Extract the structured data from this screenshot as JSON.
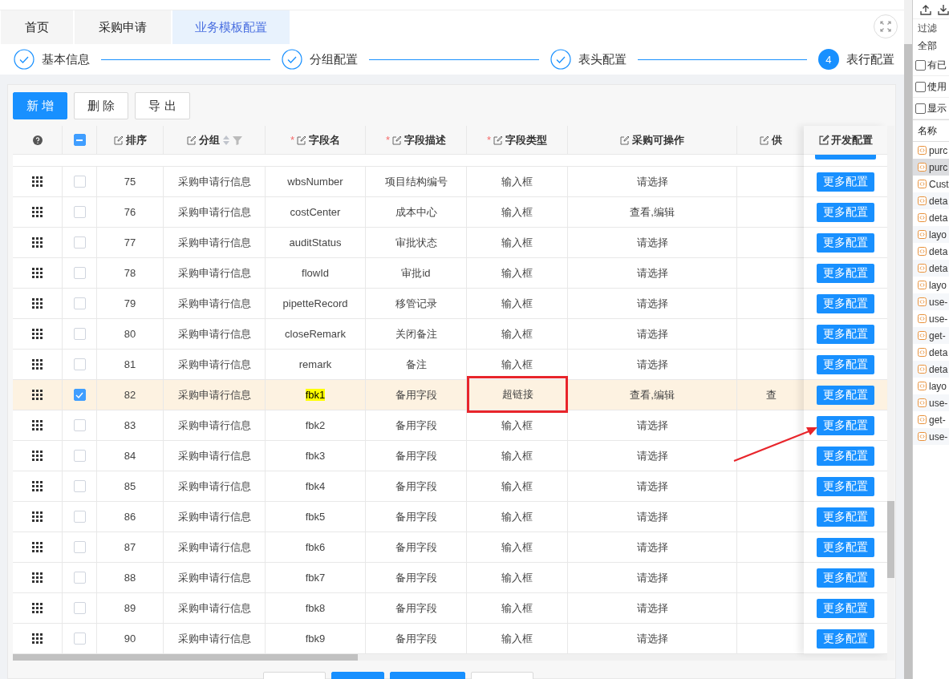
{
  "tabs": [
    {
      "label": "首页",
      "selected": false
    },
    {
      "label": "采购申请",
      "selected": false
    },
    {
      "label": "业务模板配置",
      "selected": true
    }
  ],
  "steps": [
    {
      "label": "基本信息",
      "done": true
    },
    {
      "label": "分组配置",
      "done": true
    },
    {
      "label": "表头配置",
      "done": true
    },
    {
      "label": "表行配置",
      "done": false,
      "number": "4"
    }
  ],
  "toolbar": [
    {
      "label": "新 增",
      "kind": "primary"
    },
    {
      "label": "删 除",
      "kind": "default"
    },
    {
      "label": "导 出",
      "kind": "default"
    }
  ],
  "table": {
    "header_indeterminate": true,
    "columns": [
      {
        "label": "排序"
      },
      {
        "label": "分组",
        "sortable": true
      },
      {
        "required_mark": "*",
        "label": "字段名"
      },
      {
        "required_mark": "*",
        "label": "字段描述"
      },
      {
        "required_mark": "*",
        "label": "字段类型"
      },
      {
        "label": "采购可操作"
      },
      {
        "label": "供"
      }
    ],
    "fixed_column": "开发配置",
    "rows": [
      {
        "order": "75",
        "group": "采购申请行信息",
        "field": "wbsNumber",
        "desc": "项目结构编号",
        "type": "输入框",
        "ops": "请选择",
        "action": "更多配置",
        "selected": false,
        "highlighted": false,
        "marked": false
      },
      {
        "order": "76",
        "group": "采购申请行信息",
        "field": "costCenter",
        "desc": "成本中心",
        "type": "输入框",
        "ops": "查看,编辑",
        "action": "更多配置",
        "selected": false,
        "highlighted": false,
        "marked": false
      },
      {
        "order": "77",
        "group": "采购申请行信息",
        "field": "auditStatus",
        "desc": "审批状态",
        "type": "输入框",
        "ops": "请选择",
        "action": "更多配置",
        "selected": false,
        "highlighted": false,
        "marked": false
      },
      {
        "order": "78",
        "group": "采购申请行信息",
        "field": "flowId",
        "desc": "审批id",
        "type": "输入框",
        "ops": "请选择",
        "action": "更多配置",
        "selected": false,
        "highlighted": false,
        "marked": false
      },
      {
        "order": "79",
        "group": "采购申请行信息",
        "field": "pipetteRecord",
        "desc": "移管记录",
        "type": "输入框",
        "ops": "请选择",
        "action": "更多配置",
        "selected": false,
        "highlighted": false,
        "marked": false
      },
      {
        "order": "80",
        "group": "采购申请行信息",
        "field": "closeRemark",
        "desc": "关闭备注",
        "type": "输入框",
        "ops": "请选择",
        "action": "更多配置",
        "selected": false,
        "highlighted": false,
        "marked": false
      },
      {
        "order": "81",
        "group": "采购申请行信息",
        "field": "remark",
        "desc": "备注",
        "type": "输入框",
        "ops": "请选择",
        "action": "更多配置",
        "selected": false,
        "highlighted": false,
        "marked": false
      },
      {
        "order": "82",
        "group": "采购申请行信息",
        "field": "fbk1",
        "desc": "备用字段",
        "type": "超链接",
        "ops": "查看,编辑",
        "column_9": "查",
        "action": "更多配置",
        "selected": true,
        "highlighted": true,
        "marked": true
      },
      {
        "order": "83",
        "group": "采购申请行信息",
        "field": "fbk2",
        "desc": "备用字段",
        "type": "输入框",
        "ops": "请选择",
        "action": "更多配置",
        "selected": false,
        "highlighted": false,
        "marked": false
      },
      {
        "order": "84",
        "group": "采购申请行信息",
        "field": "fbk3",
        "desc": "备用字段",
        "type": "输入框",
        "ops": "请选择",
        "action": "更多配置",
        "selected": false,
        "highlighted": false,
        "marked": false
      },
      {
        "order": "85",
        "group": "采购申请行信息",
        "field": "fbk4",
        "desc": "备用字段",
        "type": "输入框",
        "ops": "请选择",
        "action": "更多配置",
        "selected": false,
        "highlighted": false,
        "marked": false
      },
      {
        "order": "86",
        "group": "采购申请行信息",
        "field": "fbk5",
        "desc": "备用字段",
        "type": "输入框",
        "ops": "请选择",
        "action": "更多配置",
        "selected": false,
        "highlighted": false,
        "marked": false
      },
      {
        "order": "87",
        "group": "采购申请行信息",
        "field": "fbk6",
        "desc": "备用字段",
        "type": "输入框",
        "ops": "请选择",
        "action": "更多配置",
        "selected": false,
        "highlighted": false,
        "marked": false
      },
      {
        "order": "88",
        "group": "采购申请行信息",
        "field": "fbk7",
        "desc": "备用字段",
        "type": "输入框",
        "ops": "请选择",
        "action": "更多配置",
        "selected": false,
        "highlighted": false,
        "marked": false
      },
      {
        "order": "89",
        "group": "采购申请行信息",
        "field": "fbk8",
        "desc": "备用字段",
        "type": "输入框",
        "ops": "请选择",
        "action": "更多配置",
        "selected": false,
        "highlighted": false,
        "marked": false
      },
      {
        "order": "90",
        "group": "采购申请行信息",
        "field": "fbk9",
        "desc": "备用字段",
        "type": "输入框",
        "ops": "请选择",
        "action": "更多配置",
        "selected": false,
        "highlighted": false,
        "marked": false
      }
    ]
  },
  "devtools": {
    "filter_placeholder": "过滤",
    "all_label": "全部",
    "checkboxes": [
      {
        "label": "有已",
        "checked": false
      },
      {
        "label": "使用",
        "checked": false
      },
      {
        "label": "显示",
        "checked": false
      }
    ],
    "name_header": "名称",
    "files": [
      {
        "name": "purc",
        "selected": false
      },
      {
        "name": "purc",
        "selected": true
      },
      {
        "name": "Cust",
        "selected": false
      },
      {
        "name": "deta",
        "selected": false
      },
      {
        "name": "deta",
        "selected": false
      },
      {
        "name": "layo",
        "selected": false
      },
      {
        "name": "deta",
        "selected": false
      },
      {
        "name": "deta",
        "selected": false
      },
      {
        "name": "layo",
        "selected": false
      },
      {
        "name": "use-",
        "selected": false
      },
      {
        "name": "use-",
        "selected": false
      },
      {
        "name": "get-",
        "selected": false
      },
      {
        "name": "deta",
        "selected": false
      },
      {
        "name": "deta",
        "selected": false
      },
      {
        "name": "layo",
        "selected": false
      },
      {
        "name": "use-",
        "selected": false
      },
      {
        "name": "get-",
        "selected": false
      },
      {
        "name": "use-",
        "selected": false
      }
    ]
  }
}
